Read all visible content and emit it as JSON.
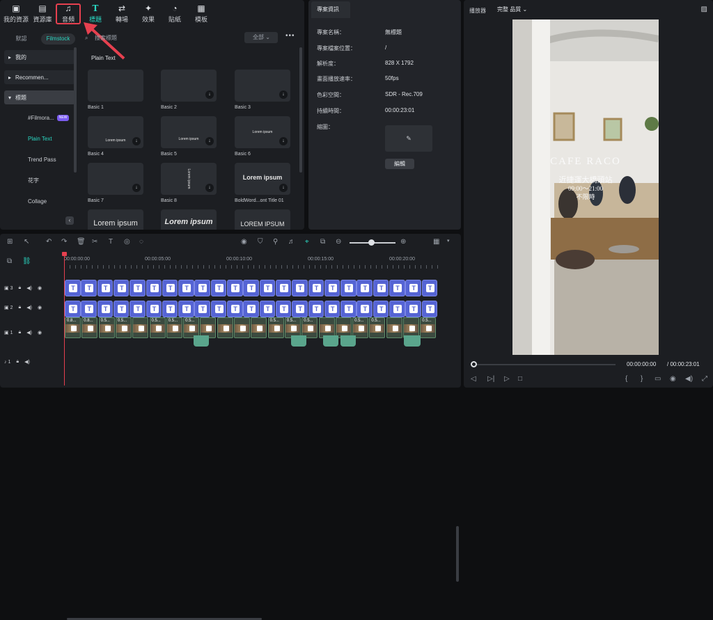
{
  "toolbar": {
    "items": [
      {
        "label": "我的資源",
        "icon": "my-media-icon"
      },
      {
        "label": "資源庫",
        "icon": "stock-media-icon"
      },
      {
        "label": "音頻",
        "icon": "music-note-icon"
      },
      {
        "label": "標題",
        "icon": "title-t-icon"
      },
      {
        "label": "轉場",
        "icon": "transition-icon"
      },
      {
        "label": "效果",
        "icon": "effects-icon"
      },
      {
        "label": "貼紙",
        "icon": "sticker-icon"
      },
      {
        "label": "模板",
        "icon": "template-icon"
      }
    ]
  },
  "sidebar": {
    "seg_default": "默認",
    "seg_filmstock": "Filmstock",
    "items": [
      {
        "label": "我的"
      },
      {
        "label": "Recommen..."
      },
      {
        "label": "標題"
      }
    ],
    "subitems": [
      {
        "label": "#Filmora...",
        "badge": "NEW"
      },
      {
        "label": "Plain Text"
      },
      {
        "label": "Trend Pass"
      },
      {
        "label": "花字"
      },
      {
        "label": "Collage"
      }
    ]
  },
  "library": {
    "search_placeholder": "搜索標題",
    "filter": "全部",
    "section_title": "Plain Text",
    "cards": [
      {
        "label": "Basic 1",
        "preview": ""
      },
      {
        "label": "Basic 2",
        "preview": ""
      },
      {
        "label": "Basic 3",
        "preview": ""
      },
      {
        "label": "Basic 4",
        "preview": "Lorem ipsum"
      },
      {
        "label": "Basic 5",
        "preview": "Lorem ipsum"
      },
      {
        "label": "Basic 6",
        "preview": "Lorem ipsum"
      },
      {
        "label": "Basic 7",
        "preview": ""
      },
      {
        "label": "Basic 8",
        "preview": "Lorem ipsum"
      },
      {
        "label": "BoldWord...ont Title 01",
        "preview": "Lorem ipsum"
      },
      {
        "label": "",
        "preview": "Lorem ipsum"
      },
      {
        "label": "",
        "preview": "Lorem ipsum"
      },
      {
        "label": "",
        "preview": "LOREM IPSUM"
      }
    ]
  },
  "project_info": {
    "tab": "專案資訊",
    "rows": [
      {
        "key": "專案名稱：",
        "value": "無標題"
      },
      {
        "key": "專案檔案位置：",
        "value": "/"
      },
      {
        "key": "解析度：",
        "value": "828 X 1792"
      },
      {
        "key": "畫面播放速率：",
        "value": "50fps"
      },
      {
        "key": "色彩空間：",
        "value": "SDR - Rec.709"
      },
      {
        "key": "持續時間：",
        "value": "00:00:23:01"
      },
      {
        "key": "縮圖：",
        "value": ""
      }
    ],
    "edit_button": "編輯"
  },
  "player": {
    "label": "播放器",
    "quality": "完整 品質",
    "overlay_title": "CAFE RACO",
    "overlay_line1": "近捷運大橋頭站",
    "overlay_line2": "09:00～21:00",
    "overlay_line3": "不限時",
    "current_time": "00:00:00:00",
    "total_time": "/ 00:00:23:01"
  },
  "timeline": {
    "ruler": [
      "00:00:00:00",
      "00:00:05:00",
      "00:00:10:00",
      "00:00:15:00",
      "00:00:20:00"
    ],
    "tracks": [
      {
        "label": "3",
        "type": "title"
      },
      {
        "label": "2",
        "type": "title"
      },
      {
        "label": "1",
        "type": "video"
      },
      {
        "label": "1",
        "type": "audio"
      }
    ],
    "video_clip_labels": [
      "0.8...",
      "0.8...",
      "0.5...",
      "0.5...",
      "",
      "0.5...",
      "0.5...",
      "0.5...",
      "",
      "",
      "",
      "",
      "0.5...",
      "0.5...",
      "0.5...",
      "",
      "",
      "0.5...",
      "0.5...",
      "",
      "",
      "0.5..."
    ]
  },
  "colors": {
    "accent": "#2ad7c2",
    "title_clip": "#5564d4",
    "audio_clip": "#5aa58c",
    "playhead": "#e6404f"
  }
}
